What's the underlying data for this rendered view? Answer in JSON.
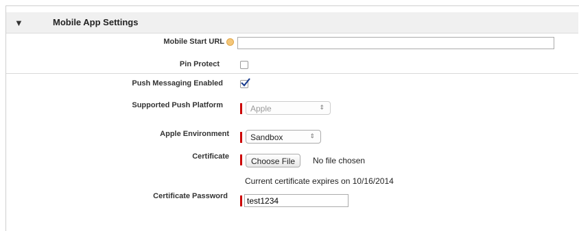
{
  "section": {
    "toggle_glyph": "▼",
    "title": "Mobile App Settings"
  },
  "fields": {
    "mobile_start_url": {
      "label": "Mobile Start URL",
      "value": "",
      "help_icon": "help-icon"
    },
    "pin_protect": {
      "label": "Pin Protect",
      "checked": false
    },
    "push_messaging": {
      "label": "Push Messaging Enabled",
      "checked": true
    },
    "push_platform": {
      "label": "Supported Push Platform",
      "selected": "Apple",
      "arrows": "⇕"
    },
    "apple_environment": {
      "label": "Apple Environment",
      "selected": "Sandbox",
      "arrows": "⇕"
    },
    "certificate": {
      "label": "Certificate",
      "button": "Choose File",
      "status": "No file chosen",
      "expiry_note": "Current certificate expires on 10/16/2014"
    },
    "certificate_password": {
      "label": "Certificate Password",
      "value": "test1234"
    }
  },
  "colors": {
    "required": "#cc0000",
    "checkmark": "#1a3d8f",
    "header_bg": "#f0f0f0"
  }
}
